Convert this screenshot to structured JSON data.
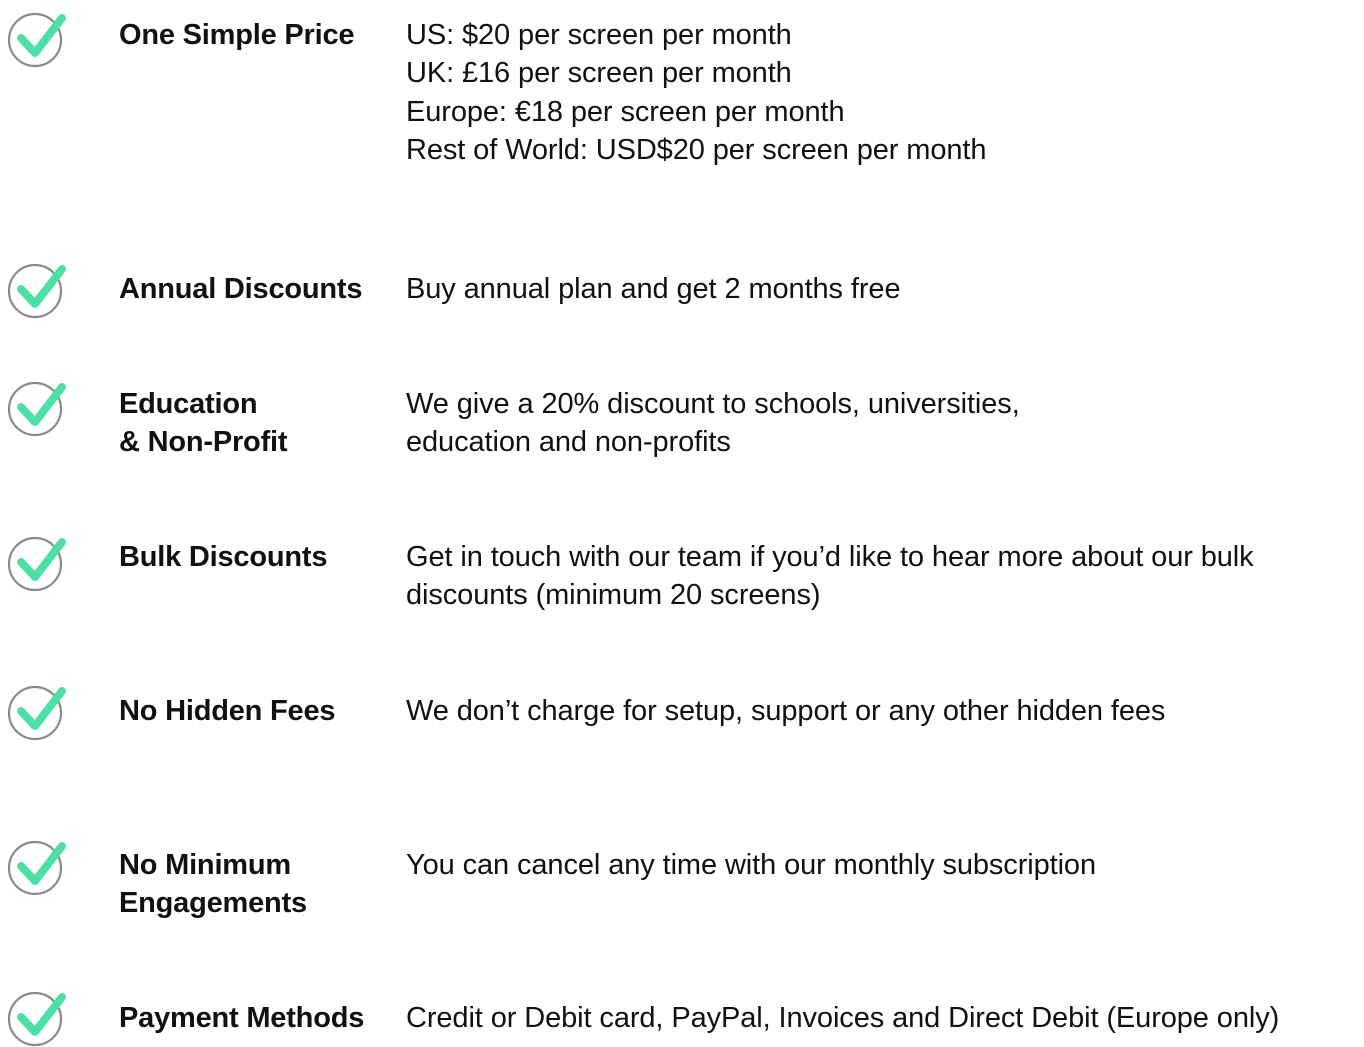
{
  "icon_name": "check-circle-icon",
  "accent_color": "#4de0a6",
  "circle_color": "#8a8a8a",
  "rows": [
    {
      "label_lines": [
        "One Simple Price"
      ],
      "desc_lines": [
        "US: $20 per screen per month",
        "UK: £16 per screen per month",
        "Europe: €18 per screen per month",
        "Rest of World: USD$20 per screen per month"
      ]
    },
    {
      "label_lines": [
        "Annual Discounts"
      ],
      "desc_lines": [
        "Buy annual plan and get 2 months free"
      ]
    },
    {
      "label_lines": [
        "Education",
        "& Non-Profit"
      ],
      "desc_lines": [
        "We give a 20% discount to schools, universities,",
        "education and non-profits"
      ]
    },
    {
      "label_lines": [
        "Bulk Discounts"
      ],
      "desc_lines": [
        "Get in touch with our team if you’d like to hear more about our bulk",
        "discounts (minimum 20 screens)"
      ]
    },
    {
      "label_lines": [
        "No Hidden Fees"
      ],
      "desc_lines": [
        "We don’t charge for setup, support or any other hidden fees"
      ]
    },
    {
      "label_lines": [
        "No Minimum",
        "Engagements"
      ],
      "desc_lines": [
        "You can cancel any time with our monthly subscription"
      ]
    },
    {
      "label_lines": [
        "Payment Methods"
      ],
      "desc_lines": [
        "Credit or Debit card, PayPal, Invoices and Direct Debit (Europe only)"
      ]
    }
  ]
}
